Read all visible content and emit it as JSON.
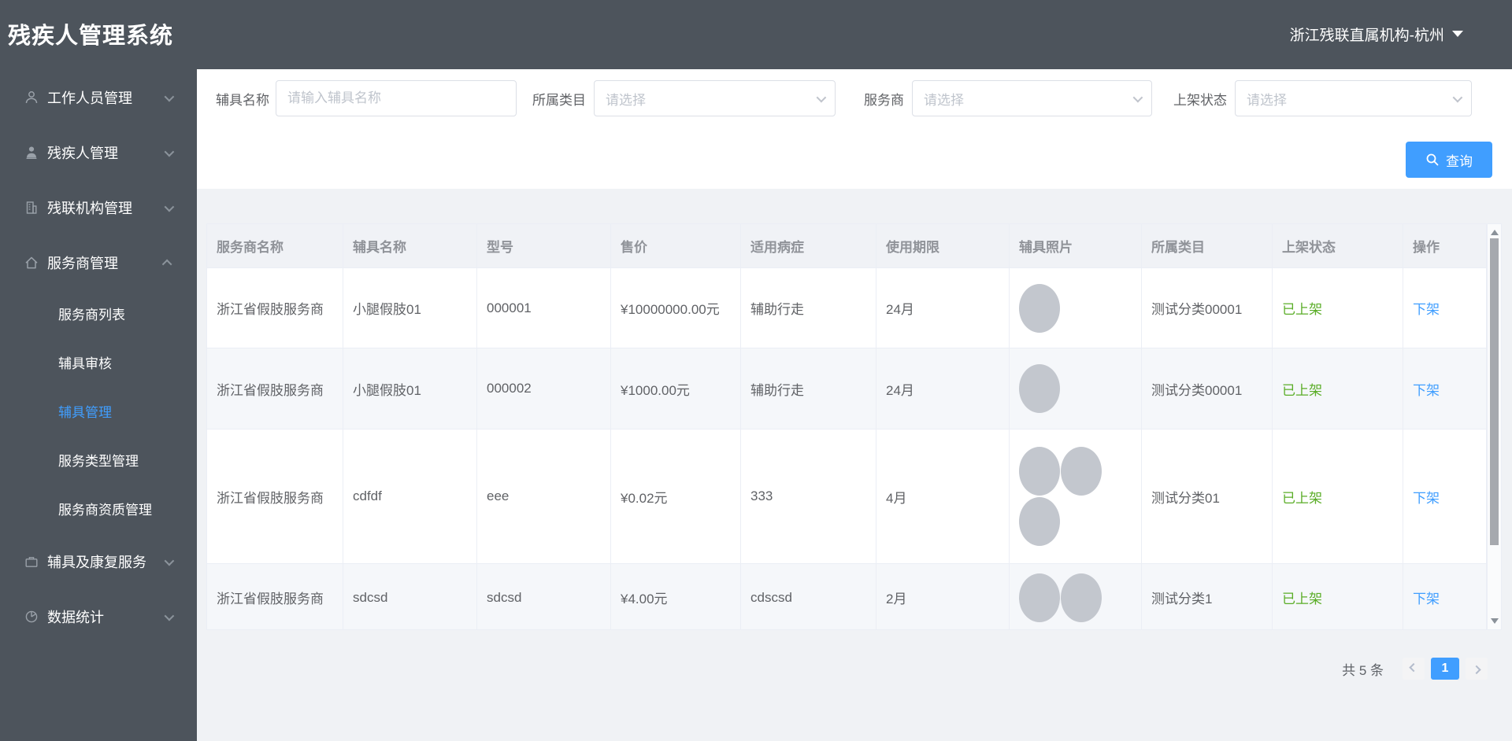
{
  "app": {
    "title": "残疾人管理系统",
    "org_switcher": "浙江残联直属机构-杭州"
  },
  "colors": {
    "header_bg": "#4d545c",
    "accent_blue": "#409eff",
    "success_green": "#5aad27",
    "striped_row": "#f5f7fa",
    "photo_gray": "#c3c7ce"
  },
  "sidebar": {
    "items": [
      {
        "label": "工作人员管理",
        "icon": "user-outline-icon",
        "expanded": false
      },
      {
        "label": "残疾人管理",
        "icon": "user-solid-icon",
        "expanded": false
      },
      {
        "label": "残联机构管理",
        "icon": "building-icon",
        "expanded": false
      },
      {
        "label": "服务商管理",
        "icon": "home-icon",
        "expanded": true,
        "children": [
          {
            "label": "服务商列表",
            "active": false
          },
          {
            "label": "辅具审核",
            "active": false
          },
          {
            "label": "辅具管理",
            "active": true
          },
          {
            "label": "服务类型管理",
            "active": false
          },
          {
            "label": "服务商资质管理",
            "active": false
          }
        ]
      },
      {
        "label": "辅具及康复服务",
        "icon": "briefcase-icon",
        "expanded": false
      },
      {
        "label": "数据统计",
        "icon": "pie-chart-icon",
        "expanded": false
      }
    ]
  },
  "filters": {
    "fields": [
      {
        "label": "辅具名称",
        "type": "input",
        "placeholder": "请输入辅具名称"
      },
      {
        "label": "所属类目",
        "type": "select",
        "placeholder": "请选择"
      },
      {
        "label": "服务商",
        "type": "select",
        "placeholder": "请选择"
      },
      {
        "label": "上架状态",
        "type": "select",
        "placeholder": "请选择"
      }
    ],
    "search_label": "查询"
  },
  "table": {
    "columns": [
      "服务商名称",
      "辅具名称",
      "型号",
      "售价",
      "适用病症",
      "使用期限",
      "辅具照片",
      "所属类目",
      "上架状态",
      "操作"
    ],
    "rows": [
      {
        "provider": "浙江省假肢服务商",
        "name": "小腿假肢01",
        "model": "000001",
        "price": "¥10000000.00元",
        "disease": "辅助行走",
        "period": "24月",
        "photos": 1,
        "category": "测试分类00001",
        "status": "已上架",
        "action": "下架"
      },
      {
        "provider": "浙江省假肢服务商",
        "name": "小腿假肢01",
        "model": "000002",
        "price": "¥1000.00元",
        "disease": "辅助行走",
        "period": "24月",
        "photos": 1,
        "category": "测试分类00001",
        "status": "已上架",
        "action": "下架"
      },
      {
        "provider": "浙江省假肢服务商",
        "name": "cdfdf",
        "model": "eee",
        "price": "¥0.02元",
        "disease": "333",
        "period": "4月",
        "photos": 3,
        "category": "测试分类01",
        "status": "已上架",
        "action": "下架"
      },
      {
        "provider": "浙江省假肢服务商",
        "name": "sdcsd",
        "model": "sdcsd",
        "price": "¥4.00元",
        "disease": "cdscsd",
        "period": "2月",
        "photos": 2,
        "category": "测试分类1",
        "status": "已上架",
        "action": "下架"
      }
    ]
  },
  "pagination": {
    "total_text": "共 5 条",
    "current_page": "1"
  }
}
